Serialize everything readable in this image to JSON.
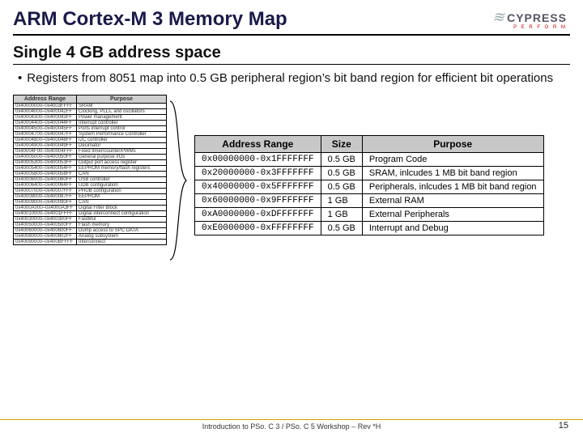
{
  "title": "ARM Cortex-M 3 Memory Map",
  "logo": {
    "text": "CYPRESS",
    "sub": "P E R F O R M"
  },
  "subheading": "Single 4 GB address space",
  "bullet": "Registers from 8051 map into 0.5 GB peripheral region’s bit band region for efficient bit operations",
  "mini_headers": [
    "Address Range",
    "Purpose"
  ],
  "mini_rows": [
    [
      "0x40000000–0x4003FFFF",
      "SRAM"
    ],
    [
      "0x40004000–0x400042FF",
      "Clocking, PLLs, and oscillators"
    ],
    [
      "0x40004300–0x400043FF",
      "Power management"
    ],
    [
      "0x40004400–0x400044FF",
      "Interrupt controller"
    ],
    [
      "0x40004500–0x400045FF",
      "Ports interrupt control"
    ],
    [
      "0x40004700–0x400047FF",
      "System Performance Controller"
    ],
    [
      "0x40004800–0x400048FF",
      "I2C controller"
    ],
    [
      "0x40004900–0x400049FF",
      "Decimator"
    ],
    [
      "0x40004F00–0x40004FFF",
      "Fixed timer/counter/PWMs"
    ],
    [
      "0x40005000–0x400050FF",
      "General purpose I/Os"
    ],
    [
      "0x40005300–0x400053FF",
      "Output port access register"
    ],
    [
      "0x40005400–0x400054FF",
      "EEPROM memory/flash registers"
    ],
    [
      "0x40005800–0x400058FF",
      "CAN"
    ],
    [
      "0x40006000–0x400060FF",
      "USB controller"
    ],
    [
      "0x40006400–0x400064FF",
      "UDB configuration"
    ],
    [
      "0x40007000–0x40007FFF",
      "PHUB configuration"
    ],
    [
      "0x40008000–0x400087FF",
      "EEPROM"
    ],
    [
      "0x40009000–0x400090FF",
      "CAN"
    ],
    [
      "0x4000A000–0x4000A3FF",
      "Digital Filter Block"
    ],
    [
      "0x40010000–0x4001FFFF",
      "Digital interconnect configuration"
    ],
    [
      "0x40030000–0x400300FF",
      "FastMul"
    ],
    [
      "0x40050000–0x400500FF",
      "Flash memory"
    ],
    [
      "0x40060000–0x400600FF",
      "Dump access to SPC DATA"
    ],
    [
      "0x40080000–0x400802FF",
      "Analog subsystem"
    ],
    [
      "0x40090000–0x400BFFFF",
      "Interconnect"
    ]
  ],
  "main_headers": [
    "Address Range",
    "Size",
    "Purpose"
  ],
  "main_rows": [
    {
      "addr": "0x00000000-0x1FFFFFFF",
      "size": "0.5 GB",
      "purpose": "Program Code"
    },
    {
      "addr": "0x20000000-0x3FFFFFFF",
      "size": "0.5 GB",
      "purpose": "SRAM, inlcudes 1 MB bit band region"
    },
    {
      "addr": "0x40000000-0x5FFFFFFF",
      "size": "0.5 GB",
      "purpose": "Peripherals, inlcudes 1 MB bit band region"
    },
    {
      "addr": "0x60000000-0x9FFFFFFF",
      "size": "1 GB",
      "purpose": "External RAM"
    },
    {
      "addr": "0xA0000000-0xDFFFFFFF",
      "size": "1 GB",
      "purpose": "External Peripherals"
    },
    {
      "addr": "0xE0000000-0xFFFFFFFF",
      "size": "0.5 GB",
      "purpose": "Interrupt and Debug"
    }
  ],
  "footer": "Introduction to PSo. C 3 / PSo. C 5 Workshop – Rev *H",
  "pagenum": "15"
}
